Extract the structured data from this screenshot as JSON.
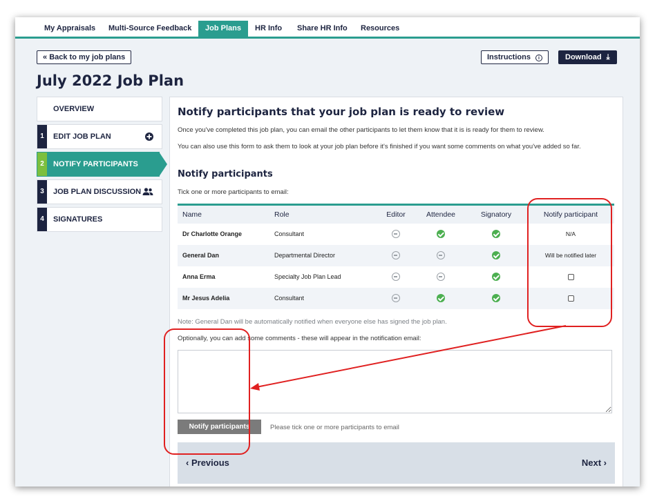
{
  "nav": {
    "tabs": [
      {
        "label": "My Appraisals"
      },
      {
        "label": "Multi-Source Feedback"
      },
      {
        "label": "Job Plans"
      },
      {
        "label": "HR Info"
      },
      {
        "label": "Share HR Info"
      },
      {
        "label": "Resources"
      }
    ]
  },
  "header": {
    "back_label": "Back to my job plans",
    "instructions_label": "Instructions",
    "download_label": "Download",
    "page_title": "July 2022 Job Plan"
  },
  "sidebar": {
    "items": [
      {
        "num": "",
        "label": "OVERVIEW"
      },
      {
        "num": "1",
        "label": "EDIT JOB PLAN"
      },
      {
        "num": "2",
        "label": "NOTIFY PARTICIPANTS"
      },
      {
        "num": "3",
        "label": "JOB PLAN DISCUSSION"
      },
      {
        "num": "4",
        "label": "SIGNATURES"
      }
    ]
  },
  "main": {
    "heading": "Notify participants that your job plan is ready to review",
    "para1": "Once you've completed this job plan, you can email the other participants to let them know that it is is ready for them to review.",
    "para2": "You can also use this form to ask them to look at your job plan before it's finished if you want some comments on what you've added so far.",
    "subheading": "Notify participants",
    "instruction": "Tick one or more participants to email:",
    "table": {
      "headers": [
        "Name",
        "Role",
        "Editor",
        "Attendee",
        "Signatory",
        "Notify participant"
      ],
      "rows": [
        {
          "name": "Dr Charlotte Orange",
          "role": "Consultant",
          "editor": "minus",
          "attendee": "check",
          "signatory": "check",
          "notify": "N/A"
        },
        {
          "name": "General Dan",
          "role": "Departmental Director",
          "editor": "minus",
          "attendee": "minus",
          "signatory": "check",
          "notify": "Will be notified later"
        },
        {
          "name": "Anna Erma",
          "role": "Specialty Job Plan Lead",
          "editor": "minus",
          "attendee": "minus",
          "signatory": "check",
          "notify": "checkbox"
        },
        {
          "name": "Mr Jesus Adelia",
          "role": "Consultant",
          "editor": "minus",
          "attendee": "check",
          "signatory": "check",
          "notify": "checkbox"
        }
      ]
    },
    "note": "Note: General Dan will be automatically notified when everyone else has signed the job plan.",
    "comment_label": "Optionally, you can add some comments - these will appear in the notification email:",
    "notify_button": "Notify participants",
    "hint": "Please tick one or more participants to email",
    "previous_label": "Previous",
    "next_label": "Next"
  },
  "colors": {
    "navy": "#1d2440",
    "teal": "#2a9d8f",
    "green": "#7cbf3f",
    "annotation_red": "#e02020"
  }
}
